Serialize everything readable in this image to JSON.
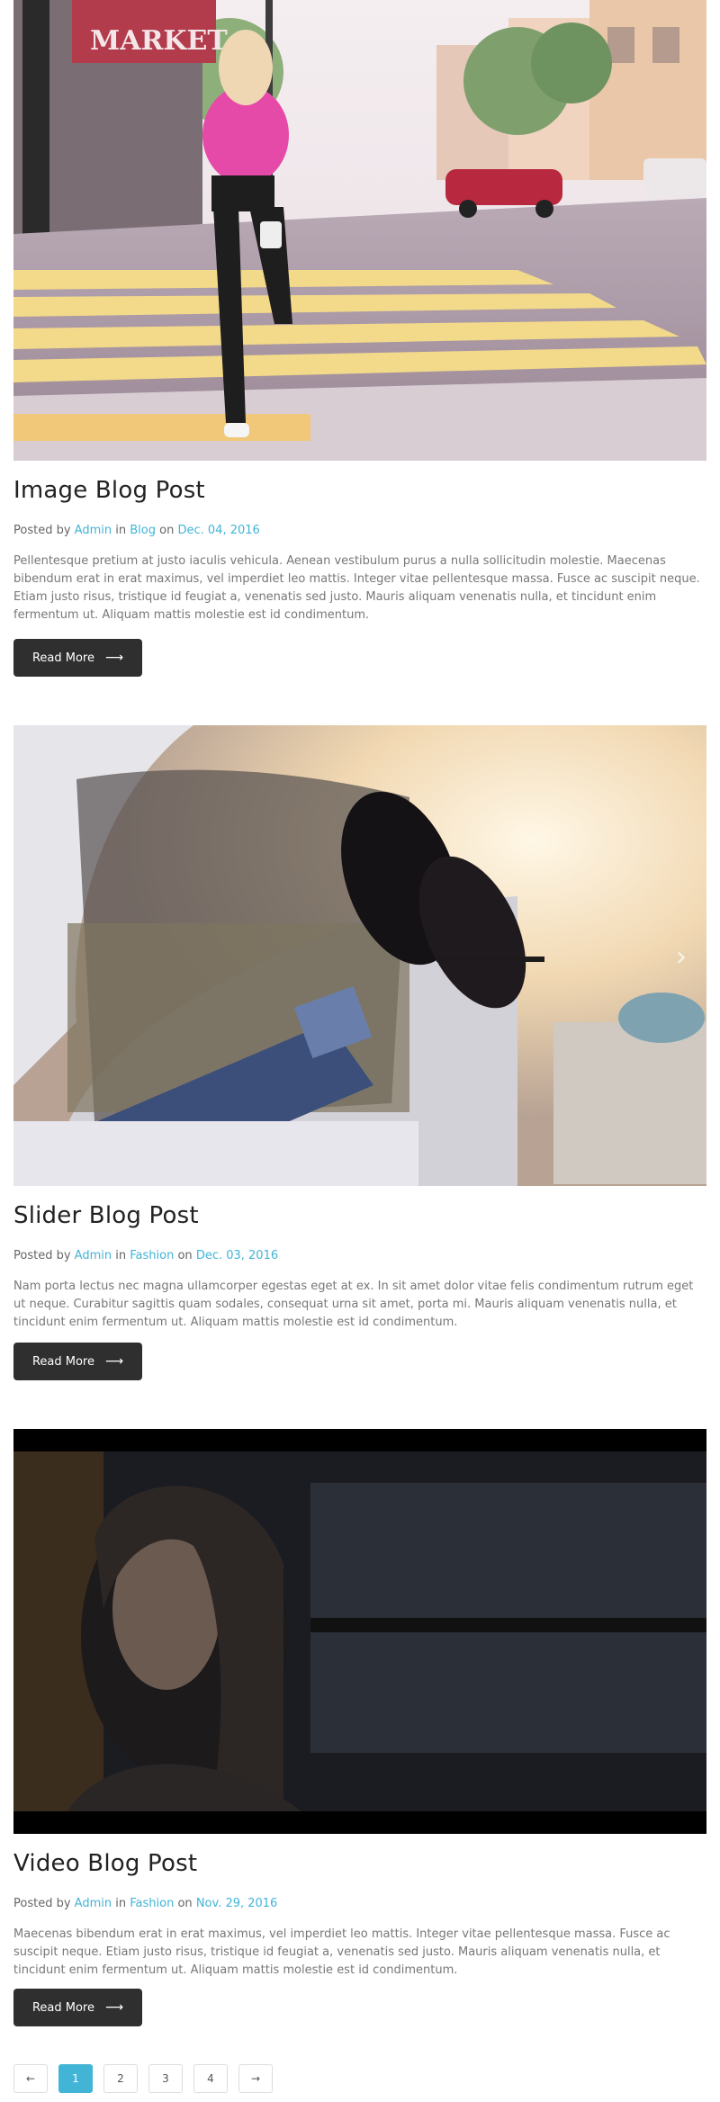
{
  "posts": [
    {
      "title": "Image Blog Post",
      "posted_by_prefix": "Posted by",
      "author": "Admin",
      "in_word": "in",
      "category": "Blog",
      "on_word": "on",
      "date": "Dec. 04, 2016",
      "excerpt": "Pellentesque pretium at justo iaculis vehicula. Aenean vestibulum purus a nulla sollicitudin molestie. Maecenas bibendum erat in erat maximus, vel imperdiet leo mattis. Integer vitae pellentesque massa. Fusce ac suscipit neque. Etiam justo risus, tristique id feugiat a, venenatis sed justo. Mauris aliquam venenatis nulla, et tincidunt enim fermentum ut. Aliquam mattis molestie est id condimentum.",
      "button_label": "Read More",
      "button_icon": "long-arrow-right-icon"
    },
    {
      "title": "Slider Blog Post",
      "posted_by_prefix": "Posted by",
      "author": "Admin",
      "in_word": "in",
      "category": "Fashion",
      "on_word": "on",
      "date": "Dec. 03, 2016",
      "excerpt": "Nam porta lectus nec magna ullamcorper egestas eget at ex. In sit amet dolor vitae felis condimentum rutrum eget ut neque. Curabitur sagittis quam sodales, consequat urna sit amet, porta mi. Mauris aliquam venenatis nulla, et tincidunt enim fermentum ut. Aliquam mattis molestie est id condimentum.",
      "button_label": "Read More",
      "button_icon": "long-arrow-right-icon"
    },
    {
      "title": "Video Blog Post",
      "posted_by_prefix": "Posted by",
      "author": "Admin",
      "in_word": "in",
      "category": "Fashion",
      "on_word": "on",
      "date": "Nov. 29, 2016",
      "excerpt": "Maecenas bibendum erat in erat maximus, vel imperdiet leo mattis. Integer vitae pellentesque massa. Fusce ac suscipit neque. Etiam justo risus, tristique id feugiat a, venenatis sed justo. Mauris aliquam venenatis nulla, et tincidunt enim fermentum ut. Aliquam mattis molestie est id condimentum.",
      "button_label": "Read More",
      "button_icon": "long-arrow-right-icon"
    }
  ],
  "pagination": {
    "prev": "←",
    "pages": [
      "1",
      "2",
      "3",
      "4"
    ],
    "current": "1",
    "next": "→"
  },
  "colors": {
    "link": "#42b4d6",
    "button_bg": "#2f2f2f",
    "active_page": "#42b4d6"
  }
}
